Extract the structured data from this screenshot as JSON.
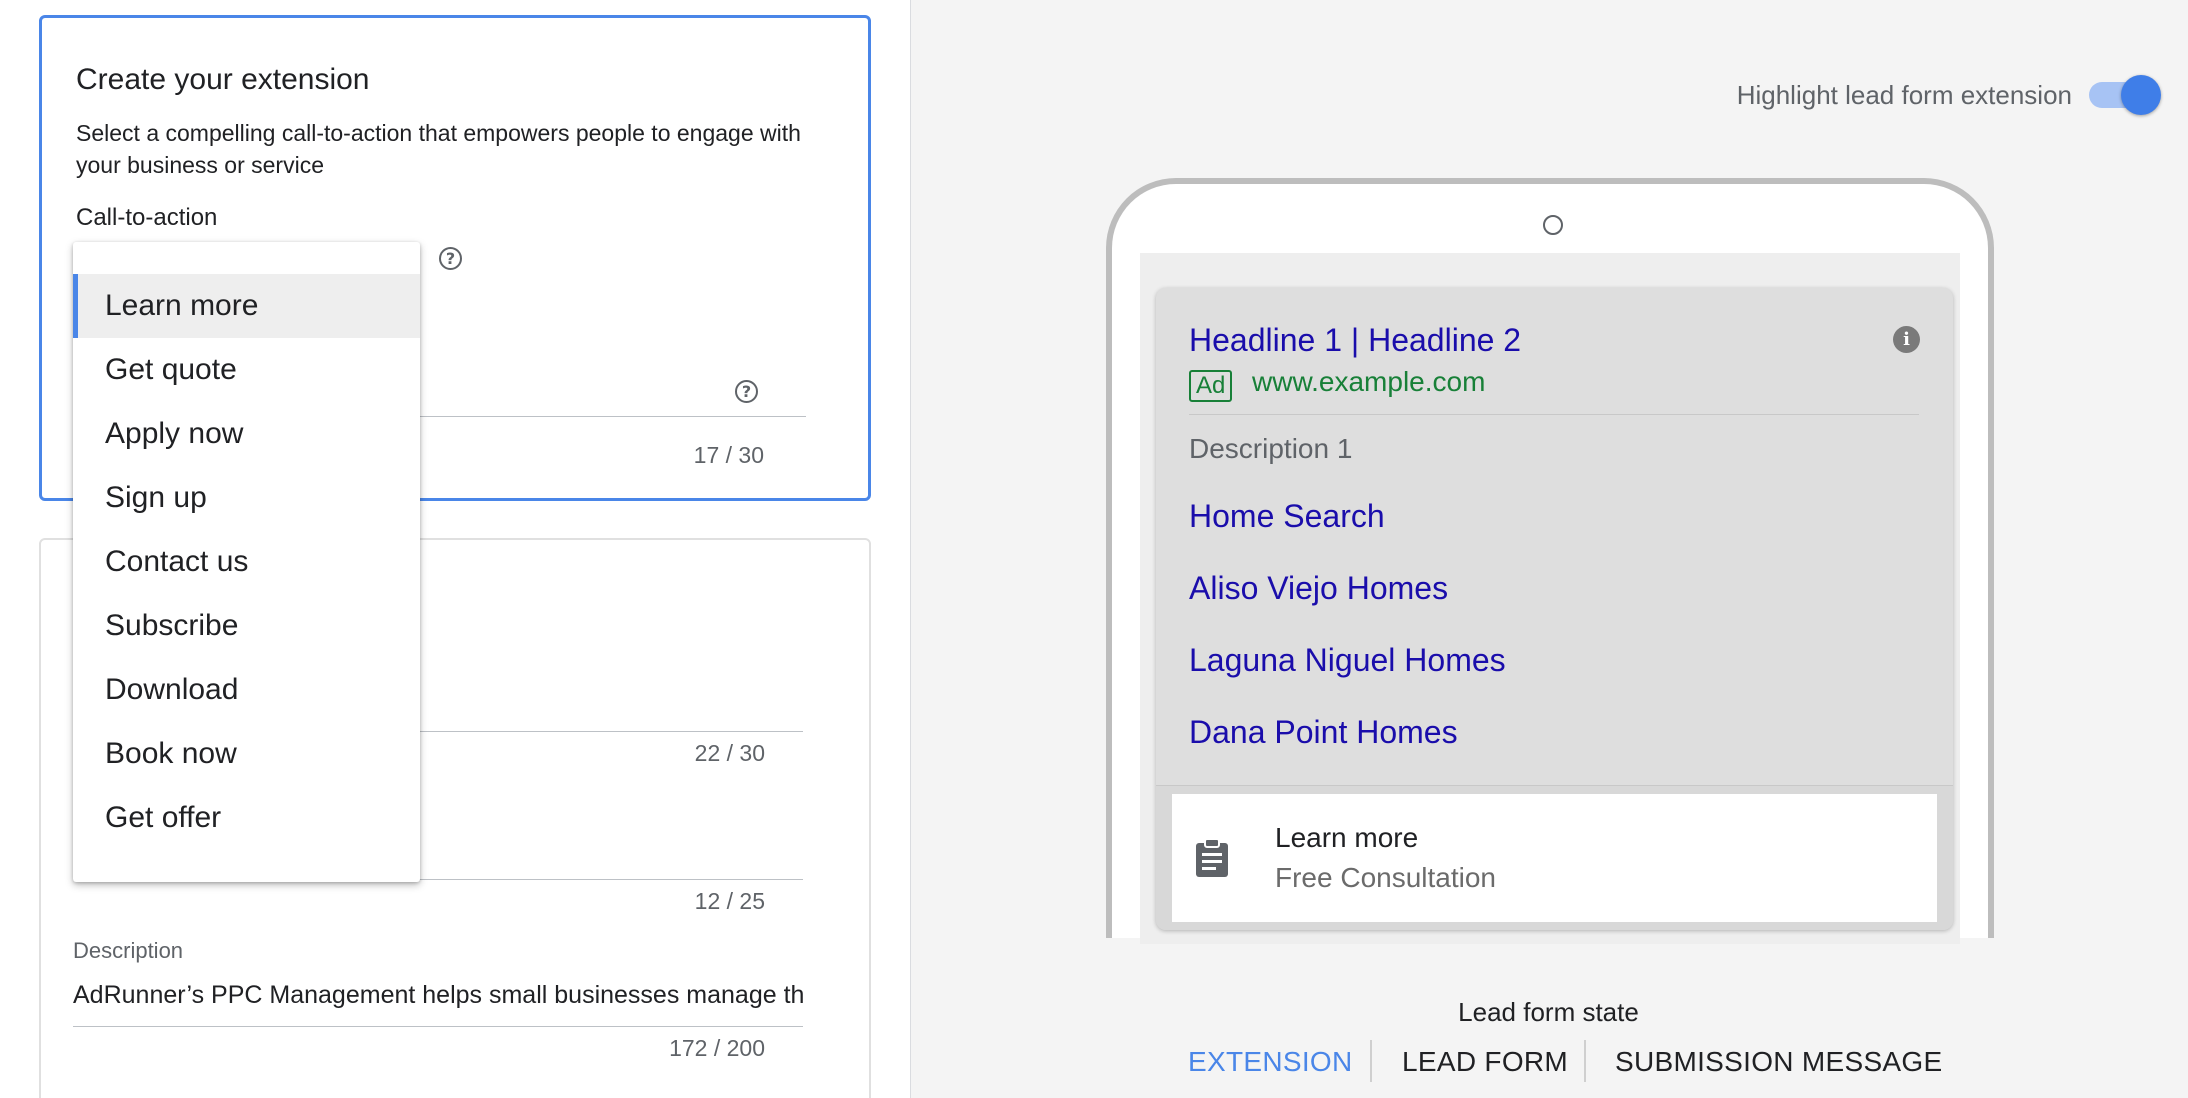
{
  "create_card": {
    "title": "Create your extension",
    "subtitle": "Select a compelling call-to-action that empowers people to engage with your business or service",
    "cta_label": "Call-to-action",
    "counter": "17 / 30"
  },
  "dropdown": {
    "options": [
      "Learn more",
      "Get quote",
      "Apply now",
      "Sign up",
      "Contact us",
      "Subscribe",
      "Download",
      "Book now",
      "Get offer"
    ],
    "selected": "Learn more"
  },
  "details_card": {
    "counter_a": "22 / 30",
    "counter_b": "12 / 25",
    "description_label": "Description",
    "description_value": "AdRunner’s PPC Management helps small businesses manage their advertising",
    "counter_c": "172 / 200"
  },
  "preview": {
    "toggle_label": "Highlight lead form extension",
    "toggle_on": true,
    "headline": "Headline 1 | Headline 2",
    "badge": "Ad",
    "url": "www.example.com",
    "description": "Description 1",
    "sitelinks": [
      "Home Search",
      "Aliso Viejo Homes",
      "Laguna Niguel Homes",
      "Dana Point Homes"
    ],
    "lead_cta": "Learn more",
    "lead_sub": "Free Consultation",
    "info_icon": "i"
  },
  "lead_form_state": {
    "label": "Lead form state",
    "tabs": [
      "EXTENSION",
      "LEAD FORM",
      "SUBMISSION MESSAGE"
    ],
    "active_tab": "EXTENSION"
  },
  "colors": {
    "accent": "#4a86e8",
    "link": "#1a0dab",
    "url_green": "#188038"
  }
}
